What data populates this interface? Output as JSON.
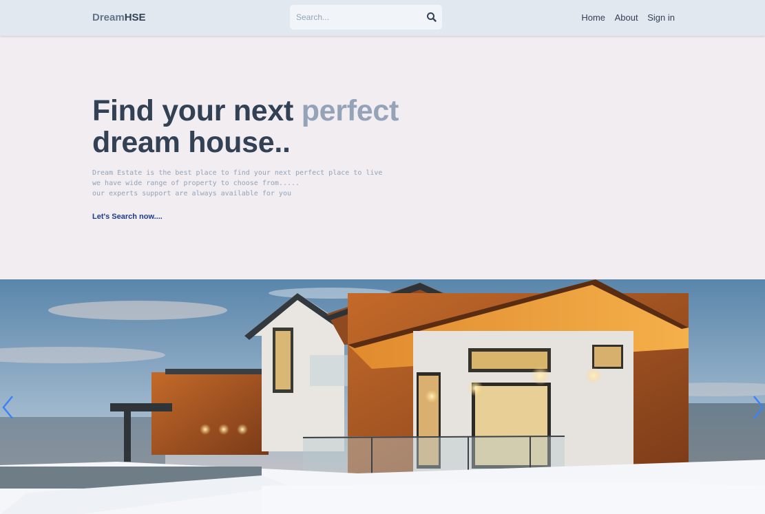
{
  "nav": {
    "brand_part1": "Dream",
    "brand_part2": "HSE",
    "search_placeholder": "Search...",
    "links": [
      "Home",
      "About",
      "Sign in"
    ]
  },
  "hero": {
    "headline_part1": "Find your next ",
    "headline_accent": "perfect",
    "headline_part2": "dream house..",
    "description": [
      "Dream Estate is the best place to find your next perfect place to live",
      "we have wide range of property to choose from.....",
      "our experts support are always available for you"
    ],
    "cta": "Let's Search now...."
  },
  "colors": {
    "navbar": "#e2e8f0",
    "page_background": "#f1edf1",
    "heading": "#334155",
    "accent": "#94a3b8",
    "link": "#1e3a8a"
  },
  "icons": {
    "search": "search-icon",
    "previous": "chevron-left-icon",
    "next": "chevron-right-icon"
  }
}
